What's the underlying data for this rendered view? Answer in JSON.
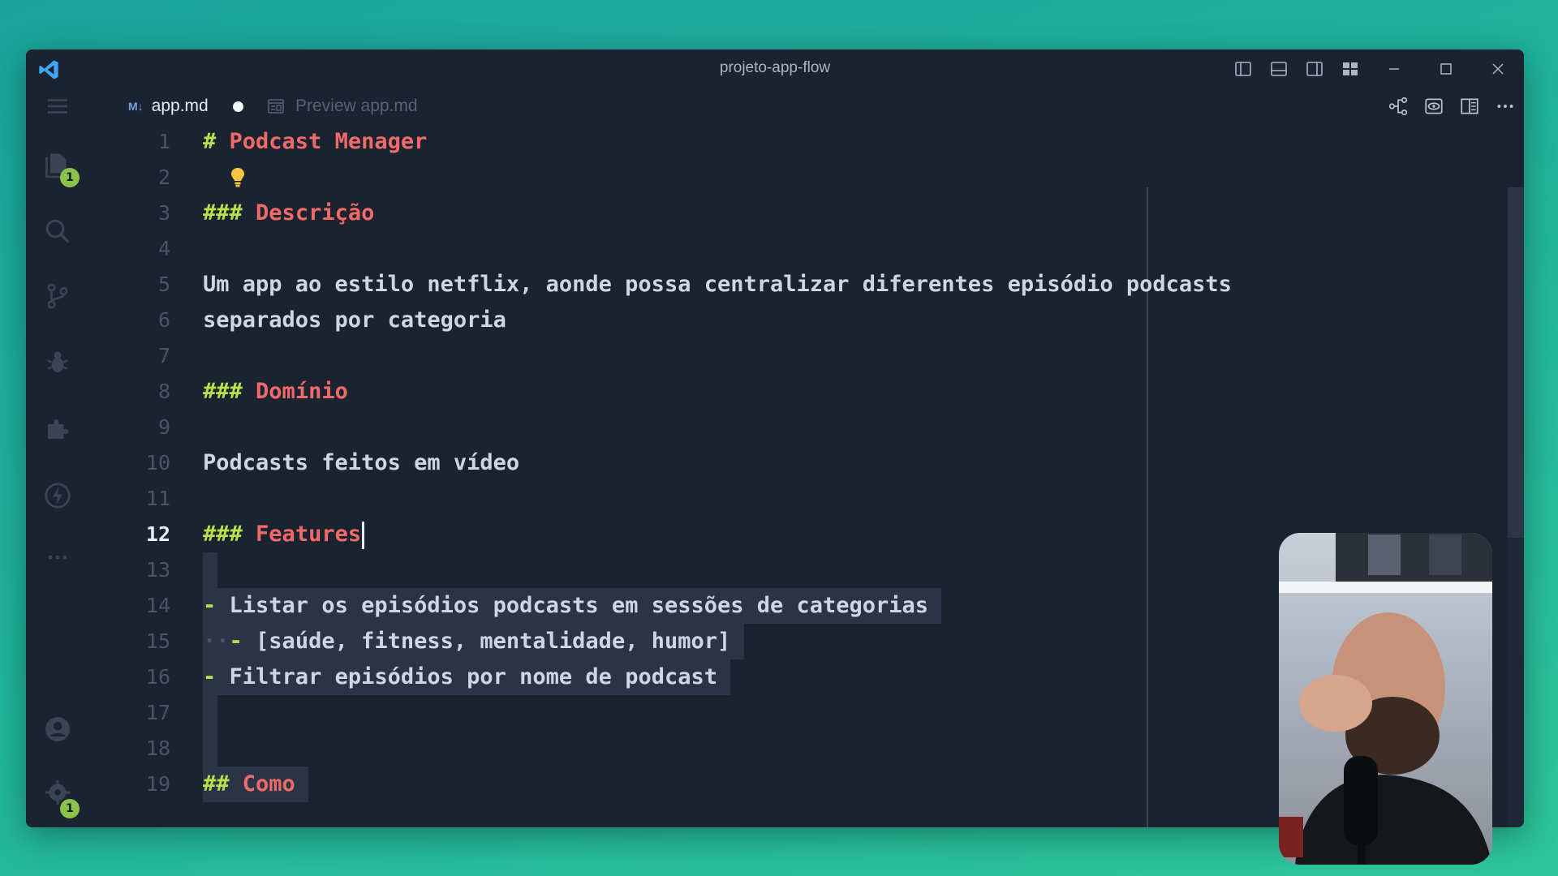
{
  "window": {
    "title": "projeto-app-flow"
  },
  "activity": {
    "explorer_badge": "1",
    "settings_badge": "1"
  },
  "tabs": [
    {
      "tag": "M↓",
      "label": "app.md",
      "modified": true
    },
    {
      "label": "Preview app.md"
    }
  ],
  "editor": {
    "lines": [
      {
        "n": "1",
        "hash": "#",
        "text": "Podcast Menager"
      },
      {
        "n": "2"
      },
      {
        "n": "3",
        "hash": "###",
        "text": "Descrição"
      },
      {
        "n": "4"
      },
      {
        "n": "5",
        "text": "Um app ao estilo netflix, aonde possa centralizar diferentes episódio podcasts"
      },
      {
        "n": "6",
        "text": "separados por categoria"
      },
      {
        "n": "7"
      },
      {
        "n": "8",
        "hash": "###",
        "text": "Domínio"
      },
      {
        "n": "9"
      },
      {
        "n": "10",
        "text": "Podcasts feitos em vídeo"
      },
      {
        "n": "11"
      },
      {
        "n": "12",
        "hash": "###",
        "text": "Features"
      },
      {
        "n": "13"
      },
      {
        "n": "14",
        "bullet": "-",
        "text": "Listar os episódios podcasts em sessões de categorias"
      },
      {
        "n": "15",
        "bullet": "-",
        "text": "[saúde, fitness, mentalidade, humor]"
      },
      {
        "n": "16",
        "bullet": "-",
        "text": "Filtrar episódios por nome de podcast"
      },
      {
        "n": "17"
      },
      {
        "n": "18"
      },
      {
        "n": "19",
        "hash": "##",
        "text": "Como"
      }
    ],
    "current_line": "12"
  },
  "colors": {
    "background": "#1b2230",
    "heading": "#f06a6a",
    "hash": "#b8e04b",
    "text": "#cdd6e3",
    "badge": "#8bc34a"
  },
  "icons": [
    "vscode-logo-icon",
    "toggle-primary-sidebar-icon",
    "toggle-panel-icon",
    "toggle-secondary-sidebar-icon",
    "customize-layout-icon",
    "minimize-icon",
    "maximize-icon",
    "close-icon",
    "explorer-icon",
    "search-icon",
    "source-control-icon",
    "run-debug-icon",
    "extensions-icon",
    "lightning-icon",
    "more-icon",
    "account-icon",
    "settings-gear-icon",
    "open-changes-icon",
    "preview-icon",
    "split-editor-icon",
    "more-actions-icon",
    "lightbulb-icon"
  ]
}
